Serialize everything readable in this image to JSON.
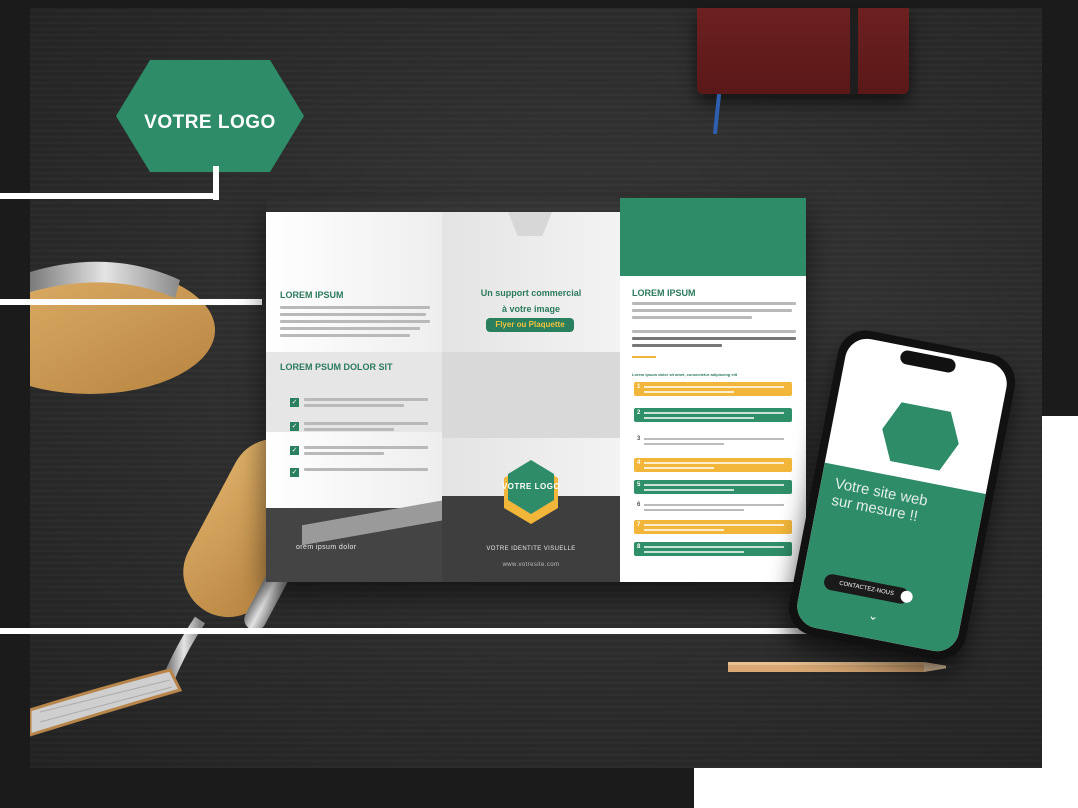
{
  "brand_colors": {
    "primary_green": "#2e8c68",
    "accent_yellow": "#f2b73a",
    "background": "#1b1b1b"
  },
  "logo_badge": {
    "text": "VOTRE LOGO"
  },
  "brochure": {
    "panel_left": {
      "heading": "LOREM IPSUM",
      "subheading": "LOREM PSUM DOLOR SIT",
      "footer_heading": "orem ipsum dolor"
    },
    "panel_center": {
      "headline_line1": "Un support commercial",
      "headline_line2": "à votre image",
      "tag": "Flyer ou Plaquette",
      "logo_text": "VOTRE LOGO",
      "identity": "VOTRE IDENTITE VISUELLE",
      "website": "www.votresite.com"
    },
    "panel_right": {
      "heading": "LOREM IPSUM",
      "list_title": "Lorem ipsum dolor sit amet, consectetur adipiscing elit",
      "item_numbers": [
        "1",
        "2",
        "3",
        "4",
        "5",
        "6",
        "7",
        "8"
      ]
    }
  },
  "phone": {
    "headline_line1": "Votre site web",
    "headline_line2": "sur mesure !!",
    "cta_label": "CONTACTEZ-NOUS",
    "scroll_icon": "chevron-down-icon"
  }
}
